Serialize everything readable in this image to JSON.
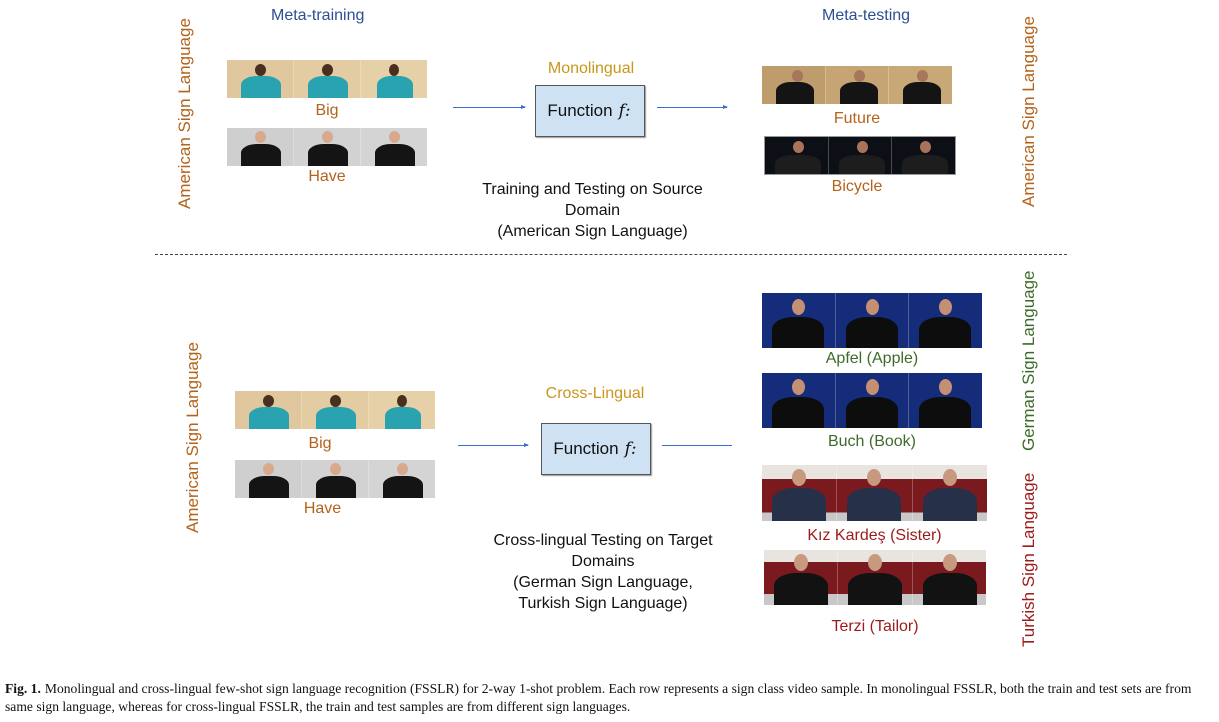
{
  "figure": {
    "mono": {
      "meta_training_label": "Meta-training",
      "meta_testing_label": "Meta-testing",
      "left_language": "American Sign Language",
      "right_language": "American Sign Language",
      "mode_label": "Monolingual",
      "function_label": "Function",
      "function_symbol": "f:",
      "description": [
        "Training and Testing on Source",
        "Domain",
        "(American Sign Language)"
      ],
      "train_samples": [
        {
          "label": "Big",
          "scene": "teal-shirt-beige-bg"
        },
        {
          "label": "Have",
          "scene": "black-shirt-grey-bg"
        }
      ],
      "test_samples": [
        {
          "label": "Future",
          "scene": "black-top-tan-bg"
        },
        {
          "label": "Bicycle",
          "scene": "black-top-dark-bg"
        }
      ]
    },
    "cross": {
      "left_language": "American Sign Language",
      "mode_label": "Cross-Lingual",
      "function_label": "Function",
      "function_symbol": "f:",
      "description": [
        "Cross-lingual Testing on Target",
        "Domains",
        "(German Sign Language,",
        "Turkish Sign Language)"
      ],
      "train_samples": [
        {
          "label": "Big",
          "scene": "teal-shirt-beige-bg"
        },
        {
          "label": "Have",
          "scene": "black-shirt-grey-bg"
        }
      ],
      "german_language": "German Sign Language",
      "turkish_language": "Turkish Sign Language",
      "german_samples": [
        {
          "label": "Apfel (Apple)",
          "scene": "blue-bg"
        },
        {
          "label": "Buch (Book)",
          "scene": "blue-bg"
        }
      ],
      "turkish_samples": [
        {
          "label": "Kız Kardeş (Sister)",
          "scene": "red-wall-plaid-shirt"
        },
        {
          "label": "Terzi (Tailor)",
          "scene": "red-wall-black-shirt"
        }
      ]
    },
    "colors": {
      "heading_blue": "#2b4f91",
      "asl_orange": "#b3631a",
      "mode_gold": "#c9961b",
      "german_green": "#3e6b2b",
      "turkish_red": "#9c1a1a",
      "function_box_fill": "#cfe2f3",
      "arrow_blue": "#3a6fd1"
    }
  },
  "caption": {
    "label": "Fig. 1.",
    "text": "Monolingual and cross-lingual few-shot sign language recognition (FSSLR) for 2-way 1-shot problem. Each row represents a sign class video sample. In monolingual FSSLR, both the train and test sets are from same sign language, whereas for cross-lingual FSSLR, the train and test samples are from different sign languages."
  }
}
